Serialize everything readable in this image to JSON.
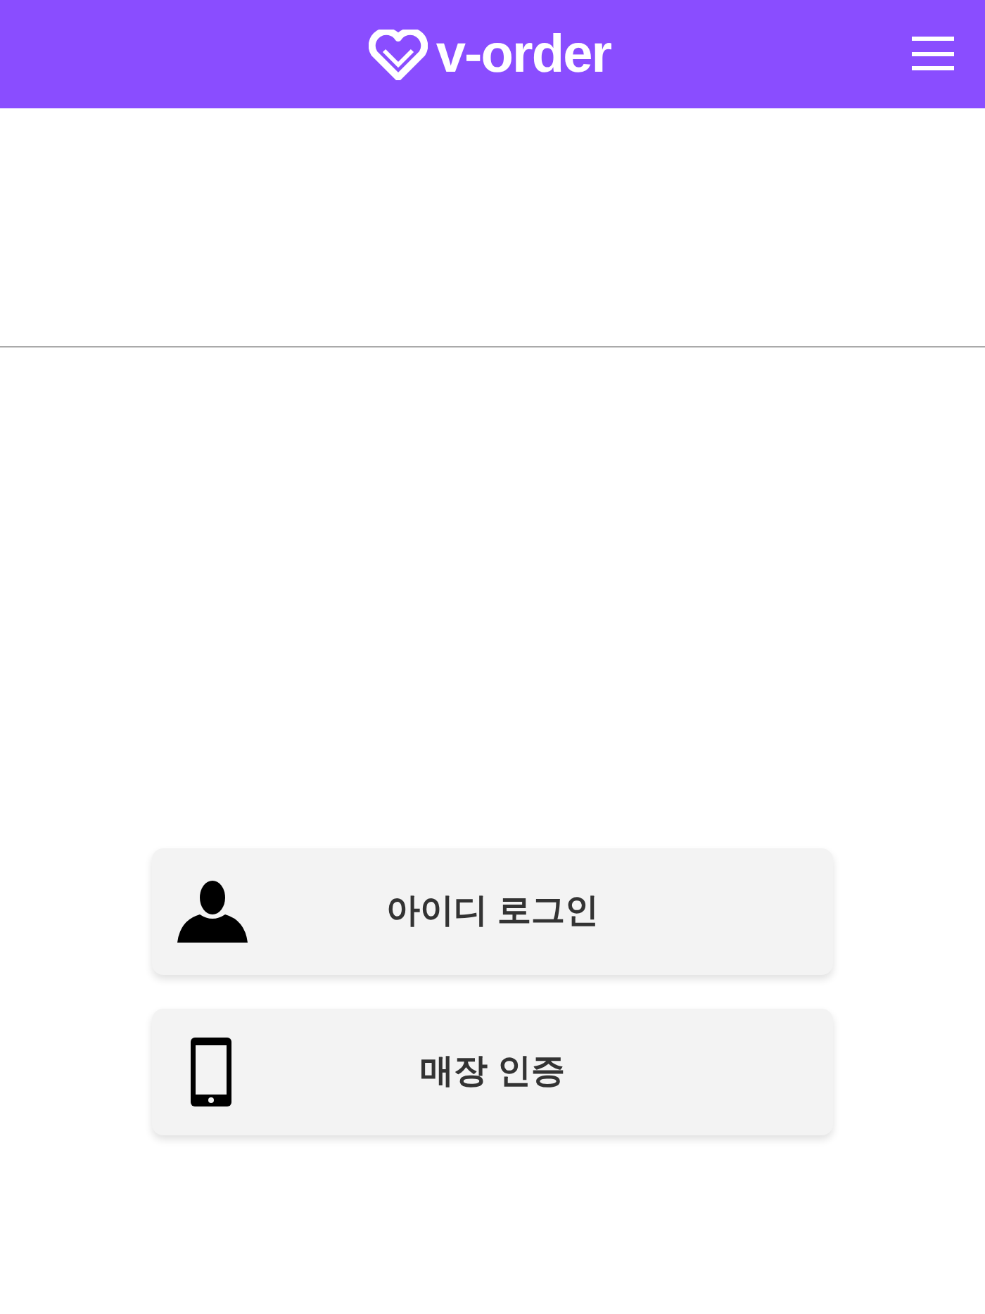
{
  "header": {
    "logo": "v-order"
  },
  "buttons": [
    {
      "kind": "person",
      "label": "아이디 로그인"
    },
    {
      "kind": "phone",
      "label": "매장 인증"
    }
  ]
}
